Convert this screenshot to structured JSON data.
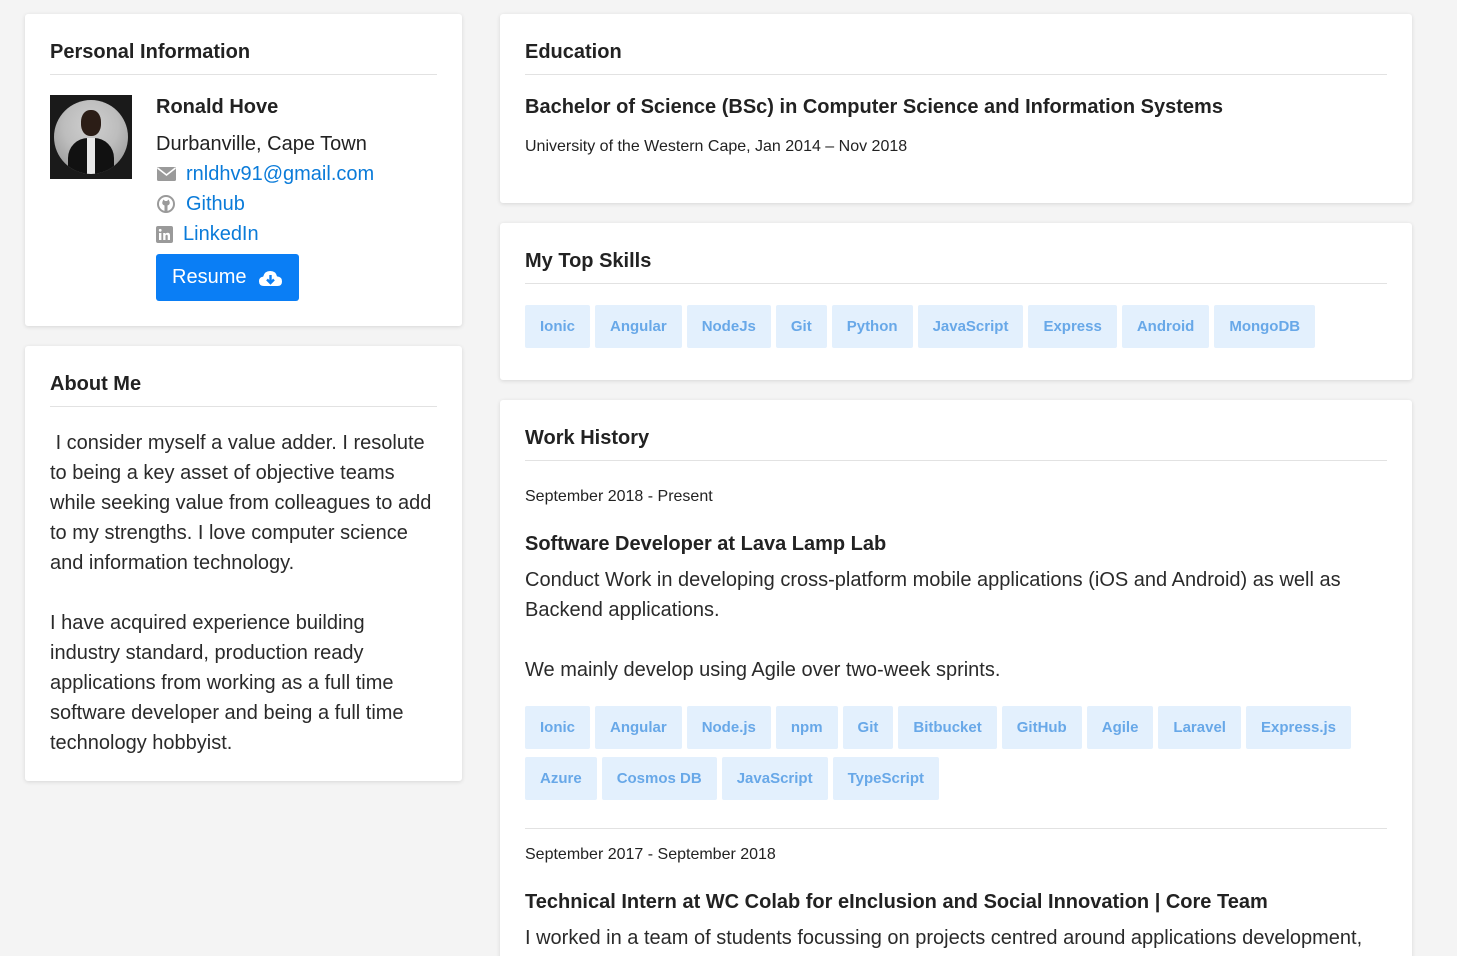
{
  "personal": {
    "title": "Personal Information",
    "name": "Ronald Hove",
    "location": "Durbanville, Cape Town",
    "email": "rnldhv91@gmail.com",
    "github": "Github",
    "linkedin": "LinkedIn",
    "resume_label": "Resume"
  },
  "about": {
    "title": "About Me",
    "text": " I consider myself a value adder. I resolute to being a key asset of objective teams while seeking value from colleagues to add to my strengths. I love computer science and information technology.\n\nI have acquired experience building industry standard, production ready applications from working as a full time software developer and being a full time technology hobbyist."
  },
  "education": {
    "title": "Education",
    "degree": "Bachelor of Science (BSc) in Computer Science and Information Systems",
    "meta": "University of the Western Cape, Jan 2014 – Nov 2018"
  },
  "skills": {
    "title": "My Top Skills",
    "items": [
      "Ionic",
      "Angular",
      "NodeJs",
      "Git",
      "Python",
      "JavaScript",
      "Express",
      "Android",
      "MongoDB"
    ]
  },
  "work": {
    "title": "Work History",
    "jobs": [
      {
        "dates": "September 2018 - Present",
        "title": "Software Developer at Lava Lamp Lab",
        "description": "Conduct Work in developing cross-platform mobile applications (iOS and Android) as well as Backend applications.\n\nWe mainly develop using Agile over two-week sprints.",
        "tags": [
          "Ionic",
          "Angular",
          "Node.js",
          "npm",
          "Git",
          "Bitbucket",
          "GitHub",
          "Agile",
          "Laravel",
          "Express.js",
          "Azure",
          "Cosmos DB",
          "JavaScript",
          "TypeScript"
        ]
      },
      {
        "dates": "September 2017 - September 2018",
        "title": "Technical Intern at WC Colab for eInclusion and Social Innovation | Core Team",
        "description": "I worked in a team of students focussing on projects centred around applications development,"
      }
    ]
  },
  "icons": {
    "email": "envelope-icon",
    "github": "github-icon",
    "linkedin": "linkedin-icon",
    "resume": "cloud-download-icon"
  },
  "colors": {
    "link": "#0a7bd9",
    "button": "#0a7ef5",
    "tag_bg": "#e3f0fd",
    "tag_text": "#68a8e8"
  }
}
